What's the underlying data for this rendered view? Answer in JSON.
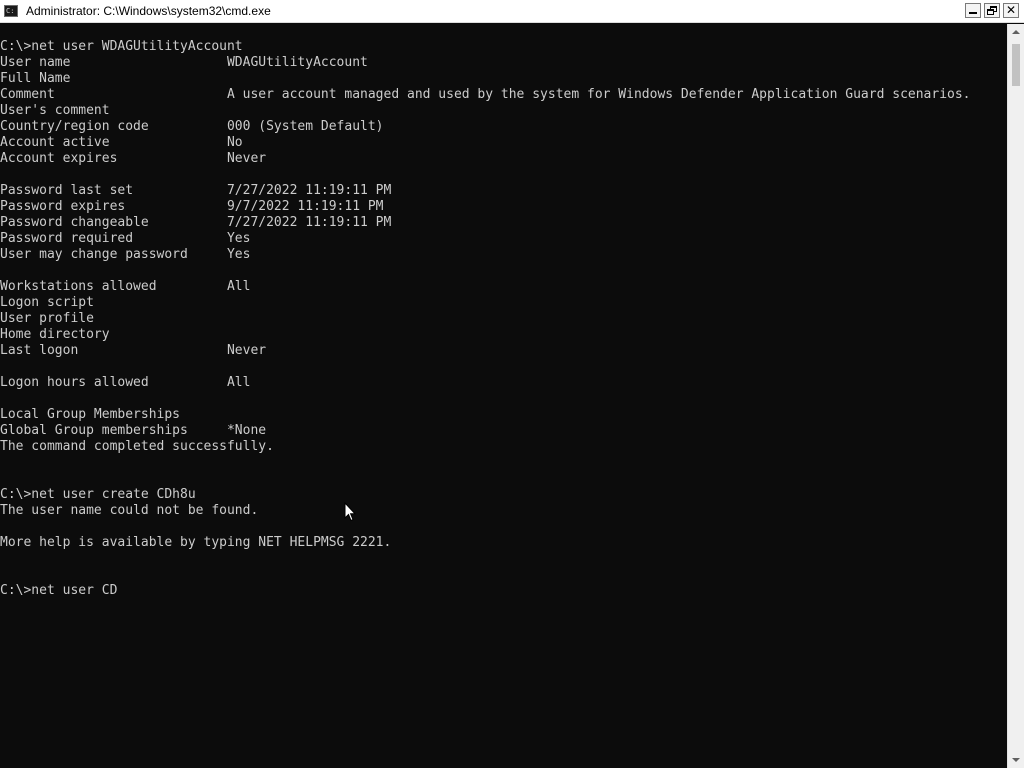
{
  "window": {
    "title": "Administrator: C:\\Windows\\system32\\cmd.exe",
    "app_icon": "cmd-icon",
    "controls": {
      "minimize": "minimize-icon",
      "restore": "restore-icon",
      "close": "close-icon",
      "close_glyph": "✕"
    }
  },
  "console": {
    "colors": {
      "background": "#0c0c0c",
      "text": "#cccccc"
    },
    "lines": [
      "C:\\>net user WDAGUtilityAccount",
      "User name                    WDAGUtilityAccount",
      "Full Name",
      "Comment                      A user account managed and used by the system for Windows Defender Application Guard scenarios.",
      "User's comment",
      "Country/region code          000 (System Default)",
      "Account active               No",
      "Account expires              Never",
      "",
      "Password last set            7/27/2022 11:19:11 PM",
      "Password expires             9/7/2022 11:19:11 PM",
      "Password changeable          7/27/2022 11:19:11 PM",
      "Password required            Yes",
      "User may change password     Yes",
      "",
      "Workstations allowed         All",
      "Logon script",
      "User profile",
      "Home directory",
      "Last logon                   Never",
      "",
      "Logon hours allowed          All",
      "",
      "Local Group Memberships",
      "Global Group memberships     *None",
      "The command completed successfully.",
      "",
      "",
      "C:\\>net user create CDh8u",
      "The user name could not be found.",
      "",
      "More help is available by typing NET HELPMSG 2221.",
      "",
      "",
      "C:\\>net user CD"
    ]
  },
  "scrollbar": {
    "up_icon": "scroll-up-arrow-icon",
    "down_icon": "scroll-down-arrow-icon"
  },
  "mouse": {
    "icon": "mouse-pointer-icon"
  }
}
